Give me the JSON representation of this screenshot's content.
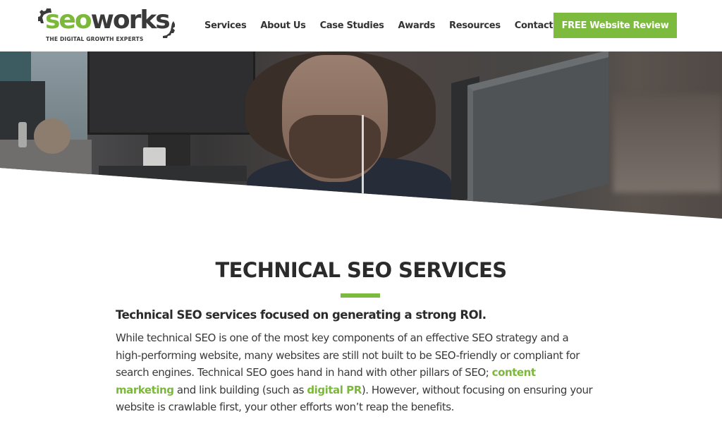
{
  "header": {
    "logo": {
      "word_primary": "seo",
      "word_secondary": "works",
      "tagline": "THE DIGITAL GROWTH EXPERTS"
    },
    "nav": [
      {
        "label": "Services"
      },
      {
        "label": "About Us"
      },
      {
        "label": "Case Studies"
      },
      {
        "label": "Awards"
      },
      {
        "label": "Resources"
      },
      {
        "label": "Contact Us"
      }
    ],
    "cta_label": "FREE Website Review"
  },
  "hero": {
    "image_description": "man with curly hair and beard wearing earphones working at a computer monitor in an office"
  },
  "content": {
    "title": "TECHNICAL SEO SERVICES",
    "subheading": "Technical SEO services focused on generating a strong ROI.",
    "paragraph": {
      "part1": "While technical SEO is one of the most key components of an effective SEO strategy and a high-performing website, many websites are still not built to be SEO-friendly or compliant for search engines. Technical SEO goes hand in hand with other pillars of SEO; ",
      "link1": "content marketing",
      "part2": " and link building (such as ",
      "link2": "digital PR",
      "part3": "). However, without focusing on ensuring your website is crawlable first, your other efforts won’t reap the benefits."
    }
  },
  "colors": {
    "brand_green": "#7dbb3e",
    "text_dark": "#2b2b2b",
    "text_body": "#3a3a3a"
  }
}
